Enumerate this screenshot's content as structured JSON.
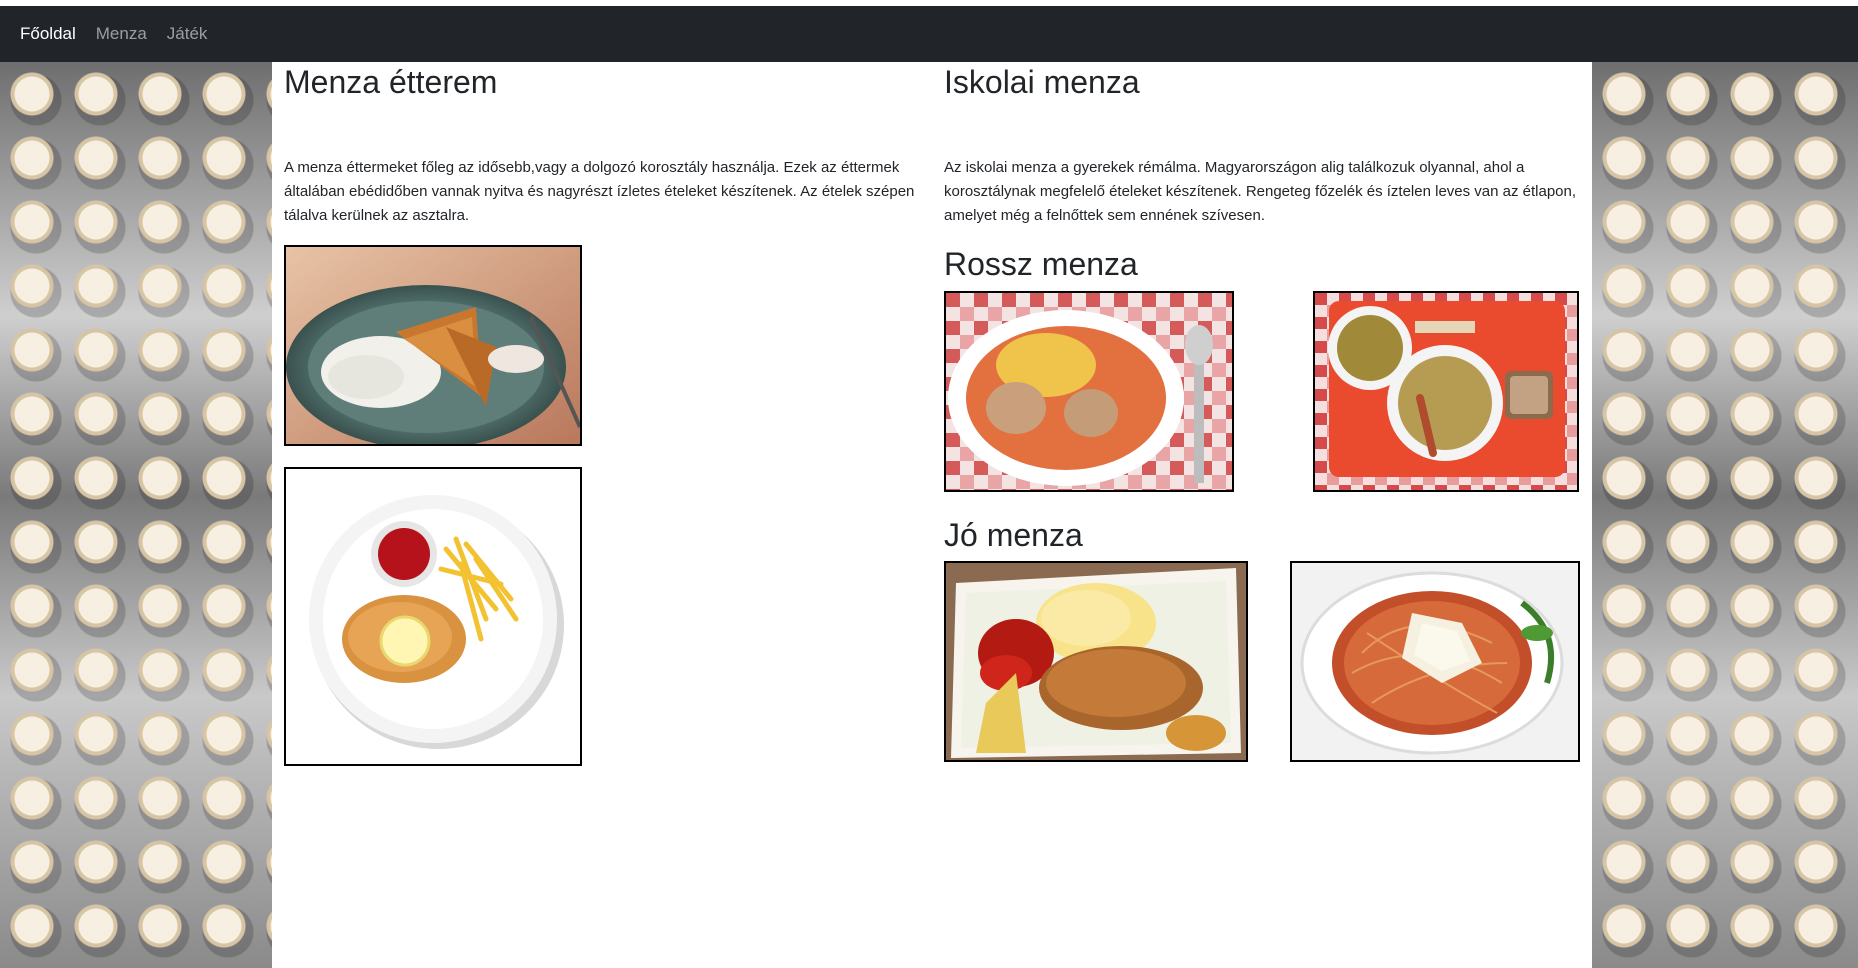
{
  "nav": {
    "items": [
      {
        "label": "Főoldal",
        "active": true
      },
      {
        "label": "Menza",
        "active": false
      },
      {
        "label": "Játék",
        "active": false
      }
    ]
  },
  "left": {
    "title": "Menza étterem",
    "text": "A menza éttermeket főleg az idősebb,vagy a dolgozó korosztály használja. Ezek az éttermek általában ebédidőben vannak nyitva és nagyrészt ízletes ételeket készítenek. Az ételek szépen tálalva kerülnek az asztalra."
  },
  "right": {
    "title": "Iskolai menza",
    "text": "Az iskolai menza a gyerekek rémálma. Magyarországon alig találkozuk olyannal, ahol a korosztálynak megfelelő ételeket készítenek. Rengeteg főzelék és íztelen leves van az étlapon, amelyet még a felnőttek sem ennének szívesen.",
    "bad_title": "Rossz menza",
    "good_title": "Jó menza"
  },
  "colors": {
    "navbar": "#212529",
    "text": "#212529"
  }
}
